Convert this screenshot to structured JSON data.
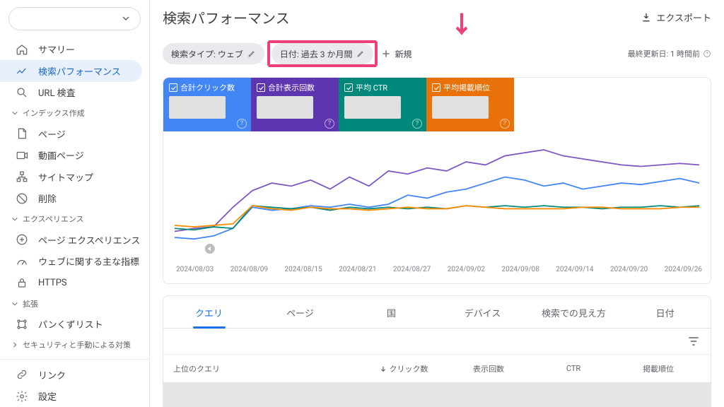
{
  "page_title": "検索パフォーマンス",
  "export_label": "エクスポート",
  "filter_chips": [
    "検索タイプ: ウェブ",
    "日付: 過去 3 か月間"
  ],
  "add_new_label": "新規",
  "last_updated": "最終更新日: 1 時間前",
  "sidebar": {
    "items": [
      {
        "label": "サマリー",
        "icon": "home"
      },
      {
        "label": "検索パフォーマンス",
        "icon": "trend",
        "active": true
      },
      {
        "label": "URL 検査",
        "icon": "search"
      }
    ],
    "sections": [
      {
        "title": "インデックス作成",
        "items": [
          {
            "label": "ページ",
            "icon": "page"
          },
          {
            "label": "動画ページ",
            "icon": "video"
          },
          {
            "label": "サイトマップ",
            "icon": "sitemap"
          },
          {
            "label": "削除",
            "icon": "remove"
          }
        ]
      },
      {
        "title": "エクスペリエンス",
        "items": [
          {
            "label": "ページ エクスペリエンス",
            "icon": "plus-circle"
          },
          {
            "label": "ウェブに関する主な指標",
            "icon": "speed"
          },
          {
            "label": "HTTPS",
            "icon": "lock"
          }
        ]
      },
      {
        "title": "拡張",
        "items": [
          {
            "label": "パンくずリスト",
            "icon": "breadcrumb"
          }
        ]
      },
      {
        "title": "セキュリティと手動による対策",
        "items": []
      }
    ],
    "bottom": [
      {
        "label": "リンク",
        "icon": "link"
      },
      {
        "label": "設定",
        "icon": "gear"
      }
    ]
  },
  "metrics": [
    {
      "label": "合計クリック数",
      "color": "m-blue"
    },
    {
      "label": "合計表示回数",
      "color": "m-purple"
    },
    {
      "label": "平均 CTR",
      "color": "m-teal"
    },
    {
      "label": "平均掲載順位",
      "color": "m-orange"
    }
  ],
  "chart_data": {
    "type": "line",
    "x_ticks": [
      "2024/08/03",
      "2024/08/09",
      "2024/08/15",
      "2024/08/21",
      "2024/08/27",
      "2024/09/02",
      "2024/09/08",
      "2024/09/14",
      "2024/09/20",
      "2024/09/26"
    ],
    "series": [
      {
        "name": "合計表示回数",
        "color": "#7e57c2",
        "values": [
          18,
          20,
          21,
          34,
          45,
          50,
          48,
          52,
          46,
          54,
          48,
          58,
          56,
          60,
          58,
          64,
          62,
          68,
          70,
          72,
          68,
          66,
          64,
          62,
          61,
          62,
          63,
          62
        ]
      },
      {
        "name": "合計クリック数",
        "color": "#4285f4",
        "values": [
          14,
          13,
          15,
          20,
          34,
          32,
          33,
          35,
          34,
          36,
          34,
          36,
          42,
          40,
          44,
          46,
          50,
          54,
          52,
          48,
          50,
          46,
          48,
          50,
          49,
          51,
          53,
          50
        ]
      },
      {
        "name": "平均 CTR",
        "color": "#00897b",
        "values": [
          20,
          19,
          21,
          20,
          35,
          34,
          33,
          34,
          32,
          34,
          33,
          34,
          33,
          34,
          33,
          35,
          34,
          35,
          34,
          35,
          34,
          34,
          33,
          34,
          34,
          35,
          34,
          35
        ]
      },
      {
        "name": "平均掲載順位",
        "color": "#fb8c00",
        "values": [
          22,
          21,
          22,
          23,
          35,
          33,
          32,
          34,
          33,
          33,
          32,
          33,
          34,
          33,
          33,
          35,
          34,
          33,
          33,
          33,
          33,
          34,
          34,
          33,
          33,
          33,
          34,
          34
        ]
      }
    ],
    "title": "",
    "xlabel": "",
    "ylabel": ""
  },
  "tabs": [
    "クエリ",
    "ページ",
    "国",
    "デバイス",
    "検索での見え方",
    "日付"
  ],
  "table": {
    "col1": "上位のクエリ",
    "sort_col": "クリック数",
    "cols": [
      "表示回数",
      "CTR",
      "掲載順位"
    ]
  }
}
